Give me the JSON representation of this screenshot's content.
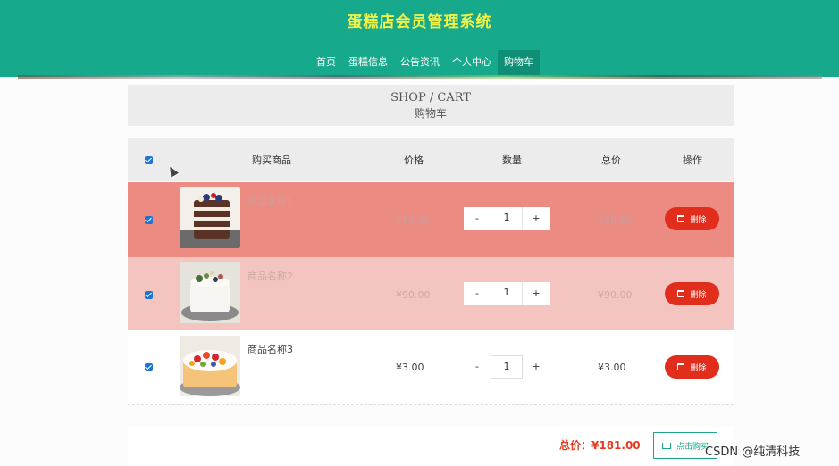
{
  "app": {
    "title": "蛋糕店会员管理系统"
  },
  "nav": [
    {
      "label": "首页",
      "active": false
    },
    {
      "label": "蛋糕信息",
      "active": false
    },
    {
      "label": "公告资讯",
      "active": false
    },
    {
      "label": "个人中心",
      "active": false
    },
    {
      "label": "购物车",
      "active": true
    }
  ],
  "cart_header": {
    "en": "SHOP / CART",
    "cn": "购物车"
  },
  "table": {
    "columns": [
      "购买商品",
      "价格",
      "数量",
      "总价",
      "操作"
    ],
    "all_checked": true,
    "rows": [
      {
        "checked": true,
        "name": "商品名称1",
        "price": "¥88.00",
        "qty": "1",
        "total": "¥88.00",
        "delete": "删除"
      },
      {
        "checked": true,
        "name": "商品名称2",
        "price": "¥90.00",
        "qty": "1",
        "total": "¥90.00",
        "delete": "删除"
      },
      {
        "checked": true,
        "name": "商品名称3",
        "price": "¥3.00",
        "qty": "1",
        "total": "¥3.00",
        "delete": "删除"
      }
    ],
    "minus": "-",
    "plus": "+"
  },
  "summary": {
    "total": "总价：¥181.00",
    "buy_label": "点击购买"
  },
  "watermark": "CSDN @纯清科技",
  "colors": {
    "header": "#17a98b",
    "brand_text": "#f2f249",
    "row1": "#ec8b82",
    "row2": "#f4c5c0",
    "delete": "#e02d1c",
    "total": "#e53a1f"
  }
}
